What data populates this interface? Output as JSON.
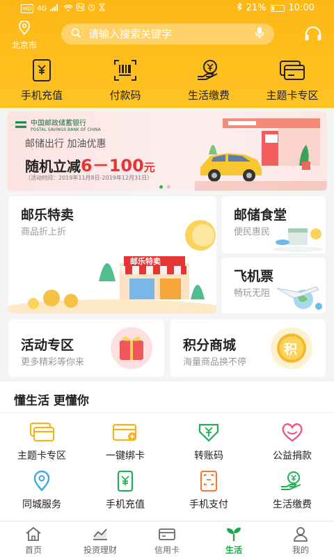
{
  "status": {
    "left_badges": [
      "HD",
      "4G"
    ],
    "battery_percent": "21%",
    "battery_level": 0.21,
    "time": "10:00"
  },
  "header": {
    "location_icon": "location-pin-icon",
    "city": "北京市",
    "search": {
      "placeholder": "请输入搜索关键字",
      "icon": "search-icon",
      "mic_icon": "mic-icon"
    },
    "service_icon": "headset-icon"
  },
  "quick_actions": [
    {
      "label": "手机充值",
      "icon": "phone-recharge-icon"
    },
    {
      "label": "付款码",
      "icon": "barcode-icon"
    },
    {
      "label": "生活缴费",
      "icon": "hand-coin-icon"
    },
    {
      "label": "主题卡专区",
      "icon": "theme-card-icon"
    }
  ],
  "banner": {
    "bank_name": "中国邮政储蓄银行",
    "bank_en": "POSTAL SAVINGS BANK OF CHINA",
    "subtitle": "邮储出行 加油优惠",
    "headline": "随机立减",
    "amount": "6－100",
    "unit": "元",
    "date": "（活动时间：2019年11月8日-2019年12月31日）",
    "pages": 2,
    "current_page": 1
  },
  "promo_cards": {
    "youle": {
      "title": "邮乐特卖",
      "subtitle": "商品折上折",
      "shop_sign": "邮乐特卖"
    },
    "canteen": {
      "title": "邮储食堂",
      "subtitle": "便民惠民"
    },
    "flight": {
      "title": "飞机票",
      "subtitle": "畅玩无阻"
    },
    "activity": {
      "title": "活动专区",
      "subtitle": "更多精彩等你来"
    },
    "points": {
      "title": "积分商城",
      "subtitle": "海量商品换不停",
      "badge": "积"
    }
  },
  "life": {
    "title": "懂生活  更懂你",
    "items": [
      {
        "label": "主题卡专区",
        "icon": "theme-card-icon"
      },
      {
        "label": "一键绑卡",
        "icon": "bind-card-icon"
      },
      {
        "label": "转账码",
        "icon": "transfer-code-icon"
      },
      {
        "label": "公益捐款",
        "icon": "heart-icon"
      },
      {
        "label": "同城服务",
        "icon": "location-icon"
      },
      {
        "label": "手机充值",
        "icon": "phone-recharge-icon"
      },
      {
        "label": "手机支付",
        "icon": "phone-pay-icon"
      },
      {
        "label": "生活缴费",
        "icon": "hand-coin-icon"
      }
    ]
  },
  "tabs": [
    {
      "label": "首页",
      "icon": "home-icon",
      "active": false
    },
    {
      "label": "投资理财",
      "icon": "chart-icon",
      "active": false
    },
    {
      "label": "信用卡",
      "icon": "credit-card-icon",
      "active": false
    },
    {
      "label": "生活",
      "icon": "sprout-icon",
      "active": true
    },
    {
      "label": "我的",
      "icon": "user-icon",
      "active": false
    }
  ],
  "colors": {
    "header_yellow": "#fdb815",
    "accent_green": "#1fa64a",
    "promo_red": "#e53534",
    "icon_yellow": "#f4b51c",
    "icon_green": "#1fae55",
    "icon_pink": "#f0557c",
    "icon_blue": "#3aa8e8",
    "icon_orange": "#f07a3a"
  }
}
